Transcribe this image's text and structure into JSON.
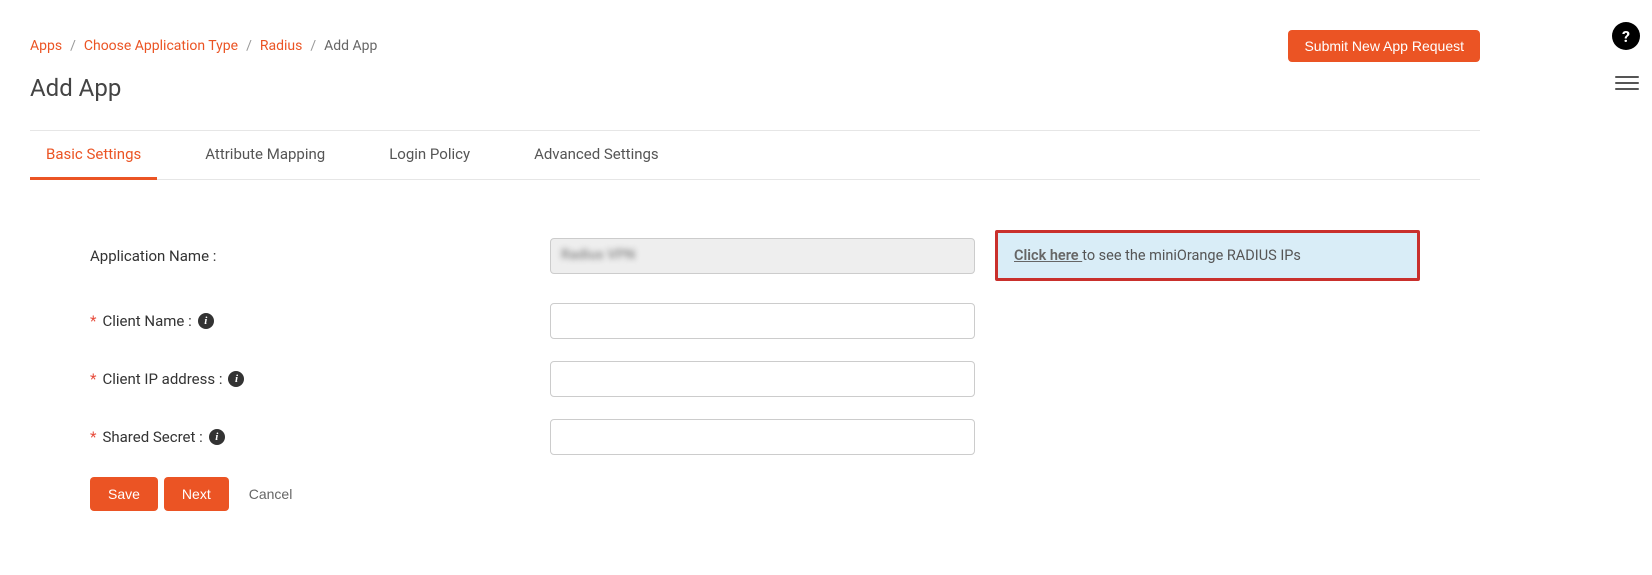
{
  "breadcrumb": {
    "items": [
      {
        "label": "Apps"
      },
      {
        "label": "Choose Application Type"
      },
      {
        "label": "Radius"
      }
    ],
    "current": "Add App",
    "separator": "/"
  },
  "header": {
    "submit_button": "Submit New App Request",
    "page_title": "Add App"
  },
  "tabs": [
    {
      "label": "Basic Settings",
      "active": true
    },
    {
      "label": "Attribute Mapping",
      "active": false
    },
    {
      "label": "Login Policy",
      "active": false
    },
    {
      "label": "Advanced Settings",
      "active": false
    }
  ],
  "form": {
    "app_name": {
      "label": "Application Name :",
      "value_redacted": "Radius  VPN"
    },
    "client_name": {
      "label": "Client Name :",
      "value": ""
    },
    "client_ip": {
      "label": "Client IP address :",
      "value": ""
    },
    "shared_secret": {
      "label": "Shared Secret :",
      "value": ""
    },
    "required_mark": "*",
    "info_glyph": "i"
  },
  "info_box": {
    "link_text": "Click here ",
    "rest_text": "to see the miniOrange RADIUS IPs"
  },
  "buttons": {
    "save": "Save",
    "next": "Next",
    "cancel": "Cancel"
  },
  "floating": {
    "help": "?"
  }
}
